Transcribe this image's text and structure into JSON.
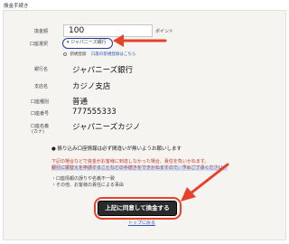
{
  "page": {
    "title": "換金手続き"
  },
  "form": {
    "amount_label": "換金額",
    "amount_value": "100",
    "amount_unit": "ポイント",
    "account_select_label": "口座選択",
    "account_select_value": "ジャパニーズ銀行",
    "new_register_label": "新規登録",
    "new_register_link": "口座の新規登録はこちら",
    "bank_label": "銀行名",
    "bank_value": "ジャパニーズ銀行",
    "branch_label": "支店名",
    "branch_value": "カジノ支店",
    "type_label": "口座種別",
    "type_value": "普通",
    "number_label": "口座番号",
    "number_value": "777555333",
    "holder_label": "口座名義",
    "holder_sublabel": "(カナ)",
    "holder_value": "ジャパニーズカジノ"
  },
  "notice": {
    "heading": "● 振り込み口座情報は必ず間違いが無いようお願いします",
    "warn_line_1": "下記の場合などで資金がお客様に到達しなかった場合、責任を負いかねます。",
    "warn_line_2": "銀行に振替えを申請することなどの手続きをできかねますので、予めご了承ください。",
    "bullet_1": "・口座情報の誤りや名義不一致",
    "bullet_2": "・その他、お客様の責任による事由"
  },
  "actions": {
    "submit_label": "上記に同意して換金する",
    "top_link_label": "トップに戻る"
  },
  "colors": {
    "arrow": "#e8412a",
    "select_border": "#1f3c9a",
    "button_bg": "#2a2a2a"
  },
  "icons": {
    "arrow": "arrow-left-icon",
    "arrow2": "arrow-down-left-icon"
  }
}
